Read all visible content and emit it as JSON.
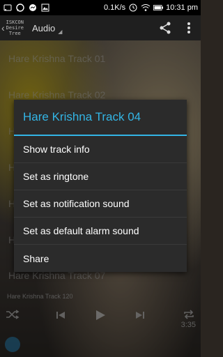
{
  "status": {
    "speed": "0.1K/s",
    "battery": "",
    "time": "10:31 pm",
    "icons": [
      "cast-icon",
      "whatsapp-icon",
      "messenger-icon",
      "gallery-icon",
      "clock-icon",
      "wifi-icon",
      "battery-icon"
    ]
  },
  "appbar": {
    "logo_lines": [
      "ISKCON",
      "Desire",
      "Tree"
    ],
    "title": "Audio",
    "icons": [
      "share-icon",
      "overflow-menu-icon"
    ]
  },
  "tracks": [
    "Hare Krishna Track 01",
    "Hare Krishna Track 02",
    "H",
    "H",
    "H",
    "H",
    "Hare Krishna Track 07"
  ],
  "dialog": {
    "title": "Hare Krishna Track 04",
    "items": [
      "Show track info",
      "Set as ringtone",
      "Set as notification sound",
      "Set as default alarm sound",
      "Share"
    ]
  },
  "player": {
    "now_playing": "Hare Krishna Track 120",
    "duration": "3:35",
    "icons": [
      "shuffle-icon",
      "previous-icon",
      "play-icon",
      "next-icon",
      "repeat-icon"
    ]
  },
  "colors": {
    "accent": "#33b5e5",
    "dialog_bg": "#2b2b2b"
  }
}
